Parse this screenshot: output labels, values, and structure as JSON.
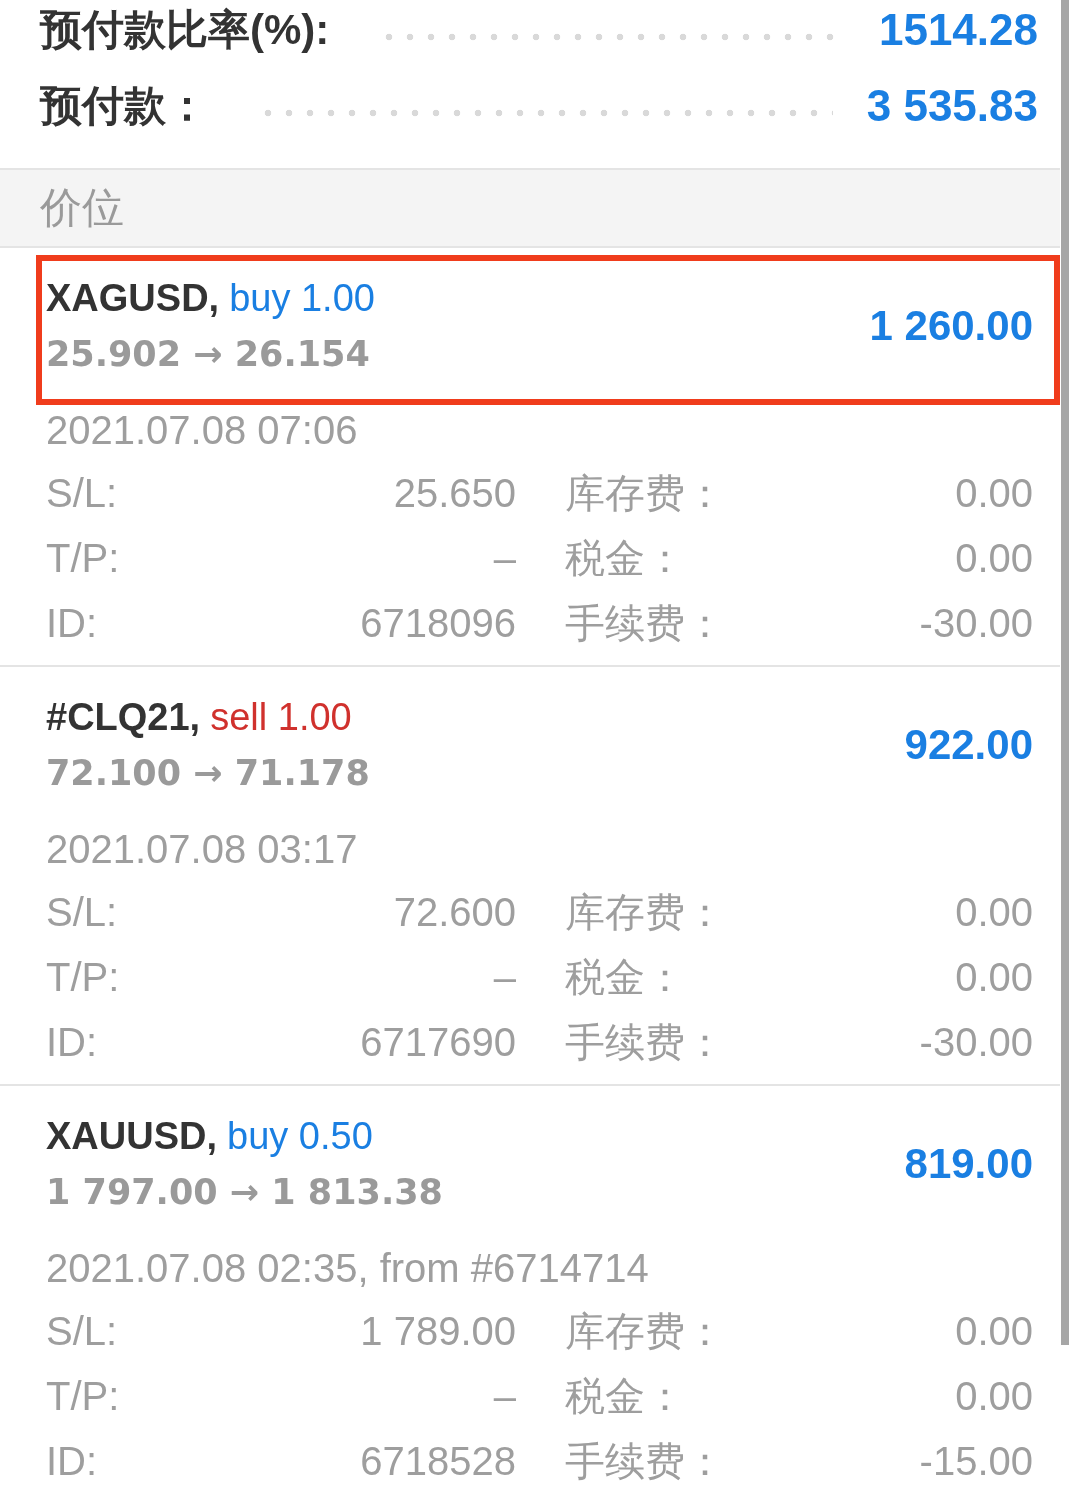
{
  "account": [
    {
      "label": "预付款比率(%):",
      "value": "1514.28"
    },
    {
      "label": "预付款：",
      "value": "3 535.83"
    }
  ],
  "section_header": "价位",
  "positions": [
    {
      "symbol": "XAGUSD,",
      "order": "buy 1.00",
      "kind": "buy",
      "prices": "25.902 → 26.154",
      "profit": "1 260.00",
      "time": "2021.07.08 07:06",
      "highlighted": true,
      "details": [
        {
          "label": "S/L:",
          "value": "25.650"
        },
        {
          "label": "库存费：",
          "value": "0.00"
        },
        {
          "label": "T/P:",
          "value": "–"
        },
        {
          "label": "税金：",
          "value": "0.00"
        },
        {
          "label": "ID:",
          "value": "6718096"
        },
        {
          "label": "手续费：",
          "value": "-30.00"
        }
      ]
    },
    {
      "symbol": "#CLQ21,",
      "order": "sell 1.00",
      "kind": "sell",
      "prices": "72.100 → 71.178",
      "profit": "922.00",
      "time": "2021.07.08 03:17",
      "highlighted": false,
      "details": [
        {
          "label": "S/L:",
          "value": "72.600"
        },
        {
          "label": "库存费：",
          "value": "0.00"
        },
        {
          "label": "T/P:",
          "value": "–"
        },
        {
          "label": "税金：",
          "value": "0.00"
        },
        {
          "label": "ID:",
          "value": "6717690"
        },
        {
          "label": "手续费：",
          "value": "-30.00"
        }
      ]
    },
    {
      "symbol": "XAUUSD,",
      "order": "buy 0.50",
      "kind": "buy",
      "prices": "1 797.00 → 1 813.38",
      "profit": "819.00",
      "time": "2021.07.08 02:35, from #6714714",
      "highlighted": false,
      "details": [
        {
          "label": "S/L:",
          "value": "1 789.00"
        },
        {
          "label": "库存费：",
          "value": "0.00"
        },
        {
          "label": "T/P:",
          "value": "–"
        },
        {
          "label": "税金：",
          "value": "0.00"
        },
        {
          "label": "ID:",
          "value": "6718528"
        },
        {
          "label": "手续费：",
          "value": "-15.00"
        }
      ]
    }
  ]
}
